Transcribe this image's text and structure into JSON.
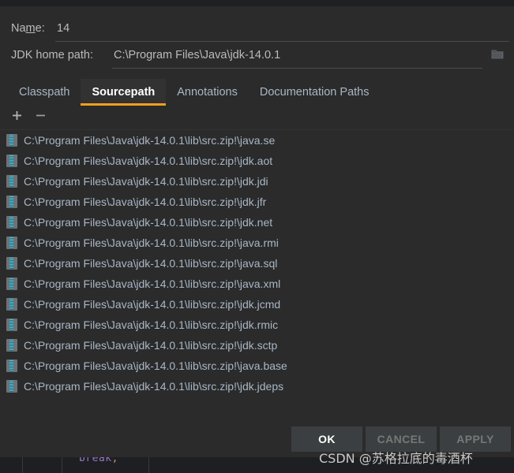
{
  "dialog": {
    "name_field": {
      "label_before": "Na",
      "label_mnemonic": "m",
      "label_after": "e:",
      "value": "14"
    },
    "jdk_home_field": {
      "label": "JDK home path:",
      "value": "C:\\Program Files\\Java\\jdk-14.0.1",
      "browse_icon": "folder-icon"
    },
    "tabs": [
      {
        "label": "Classpath",
        "selected": false
      },
      {
        "label": "Sourcepath",
        "selected": true
      },
      {
        "label": "Annotations",
        "selected": false
      },
      {
        "label": "Documentation Paths",
        "selected": false
      }
    ],
    "toolbar": {
      "add_icon": "plus-icon",
      "remove_icon": "minus-icon"
    },
    "sourcepath_entries": [
      {
        "icon": "zip-file-icon",
        "path": "C:\\Program Files\\Java\\jdk-14.0.1\\lib\\src.zip!\\java.se"
      },
      {
        "icon": "zip-file-icon",
        "path": "C:\\Program Files\\Java\\jdk-14.0.1\\lib\\src.zip!\\jdk.aot"
      },
      {
        "icon": "zip-file-icon",
        "path": "C:\\Program Files\\Java\\jdk-14.0.1\\lib\\src.zip!\\jdk.jdi"
      },
      {
        "icon": "zip-file-icon",
        "path": "C:\\Program Files\\Java\\jdk-14.0.1\\lib\\src.zip!\\jdk.jfr"
      },
      {
        "icon": "zip-file-icon",
        "path": "C:\\Program Files\\Java\\jdk-14.0.1\\lib\\src.zip!\\jdk.net"
      },
      {
        "icon": "zip-file-icon",
        "path": "C:\\Program Files\\Java\\jdk-14.0.1\\lib\\src.zip!\\java.rmi"
      },
      {
        "icon": "zip-file-icon",
        "path": "C:\\Program Files\\Java\\jdk-14.0.1\\lib\\src.zip!\\java.sql"
      },
      {
        "icon": "zip-file-icon",
        "path": "C:\\Program Files\\Java\\jdk-14.0.1\\lib\\src.zip!\\java.xml"
      },
      {
        "icon": "zip-file-icon",
        "path": "C:\\Program Files\\Java\\jdk-14.0.1\\lib\\src.zip!\\jdk.jcmd"
      },
      {
        "icon": "zip-file-icon",
        "path": "C:\\Program Files\\Java\\jdk-14.0.1\\lib\\src.zip!\\jdk.rmic"
      },
      {
        "icon": "zip-file-icon",
        "path": "C:\\Program Files\\Java\\jdk-14.0.1\\lib\\src.zip!\\jdk.sctp"
      },
      {
        "icon": "zip-file-icon",
        "path": "C:\\Program Files\\Java\\jdk-14.0.1\\lib\\src.zip!\\java.base"
      },
      {
        "icon": "zip-file-icon",
        "path": "C:\\Program Files\\Java\\jdk-14.0.1\\lib\\src.zip!\\jdk.jdeps"
      }
    ],
    "buttons": [
      {
        "label": "OK",
        "state": "primary"
      },
      {
        "label": "CANCEL",
        "state": "disabled"
      },
      {
        "label": "APPLY",
        "state": "disabled"
      }
    ]
  },
  "background_editor": {
    "code_keyword": "break",
    "code_semicolon": ";"
  },
  "watermark": {
    "text": "CSDN @苏格拉底的毒酒杯"
  },
  "colors": {
    "accent_tab_underline": "#f29f1e",
    "dialog_background": "#2b2b2b",
    "list_text": "#a9b7c6",
    "label_text": "#bbbbbb",
    "zip_icon_zipper": "#4fc3d9"
  }
}
